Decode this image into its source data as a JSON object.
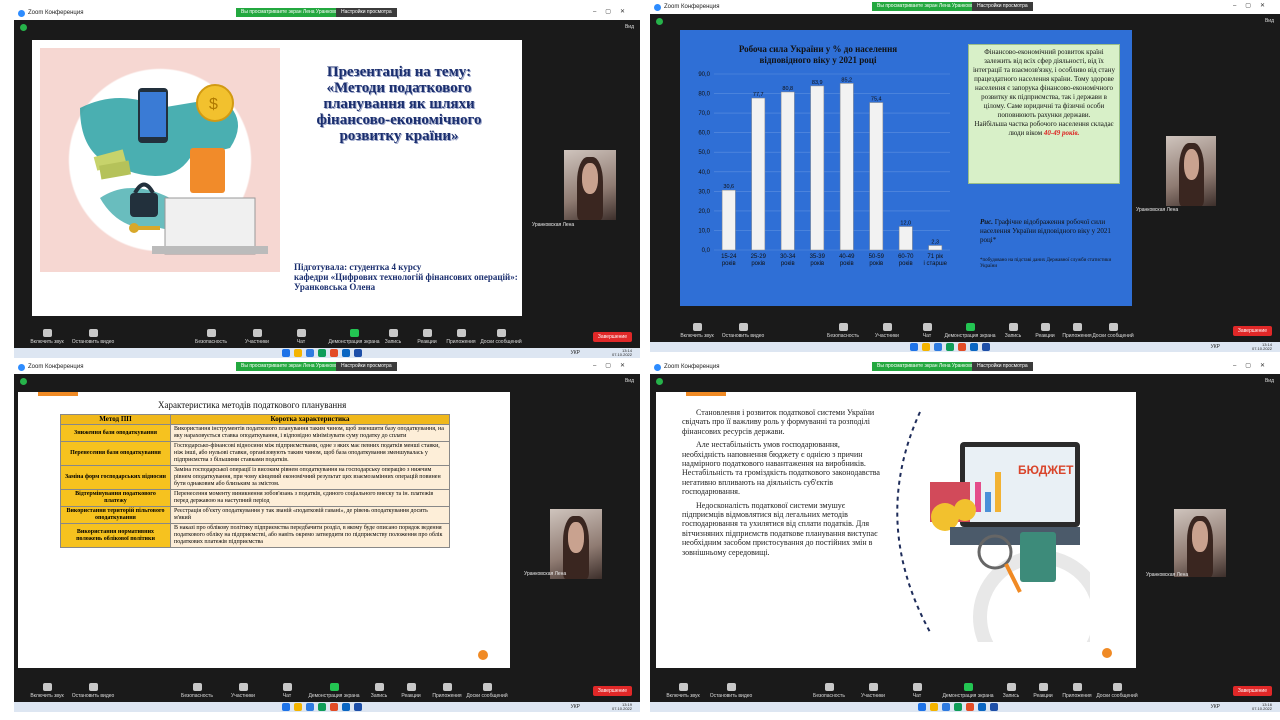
{
  "zoom": {
    "app_title": "Zoom Конференция",
    "share_banner": "Вы просматриваете экран Лена Уранковская",
    "view_settings": "Настройки просмотра",
    "view_label": "Вид",
    "participant_name": "Уранковская Лена",
    "participants_count": "11",
    "end_label": "Завершение",
    "toolbar": {
      "audio": "Включить звук",
      "video": "Остановить видео",
      "security": "Безопасность",
      "participants": "Участники",
      "chat": "Чат",
      "share": "Демонстрация экрана",
      "record": "Запись",
      "reactions": "Реакции",
      "apps": "Приложения",
      "whiteboards": "Доски сообщений"
    }
  },
  "taskbar": {
    "lang": "УКР",
    "times": [
      "13:14",
      "13:14",
      "13:19",
      "13:16"
    ],
    "date": "07.10.2022",
    "icon_colors": [
      "#1e73e8",
      "#f4b400",
      "#2f7be0",
      "#0f9d58",
      "#e34c26",
      "#0a66c2",
      "#1e4fa8"
    ]
  },
  "slide1": {
    "title": "Презентація на тему: «Методи податкового планування як шляхи фінансово-економічного розвитку країни»",
    "prepared_line1": "Підготувала: студентка 4 курсу",
    "prepared_line2": "кафедри «Цифрових технологій фінансових операцій»:",
    "prepared_line3": "Уранковська Олена"
  },
  "slide2": {
    "info_text": "Фінансово-економічний розвиток країні залежить від всіх сфер діяльності, від їх інтеграції та взаємозв'язку, і особливо від стану працездатного населення країни. Тому здорове населення є запорука фінансово-економічного розвитку як підприємства, так і держави в цілому. Саме юридичні та фізичні особи поповнюють рахунки держави.",
    "info_highlight_prefix": "Найбільша частка робочого населення складає люди віком",
    "info_highlight": "40-49 років.",
    "caption_label": "Рис.",
    "caption": "Графічне відображення робочої сили населення України відповідного віку у 2021 році*",
    "caption_note": "*побудовано на підставі даних Державної служби статистики України"
  },
  "chart_data": {
    "type": "bar",
    "title": "Робоча сила України у % до населення відповідного віку у 2021 році",
    "categories": [
      "15-24 років",
      "25-29 років",
      "30-34 років",
      "35-39 років",
      "40-49 років",
      "50-59 років",
      "60-70 років",
      "71 рік і старше"
    ],
    "values": [
      30.6,
      77.7,
      80.8,
      83.9,
      85.2,
      75.4,
      12.0,
      2.3
    ],
    "value_labels": [
      "30,6",
      "77,7",
      "80,8",
      "83,9",
      "85,2",
      "75,4",
      "12,0",
      "2,3"
    ],
    "y_ticks": [
      "0,0",
      "10,0",
      "20,0",
      "30,0",
      "40,0",
      "50,0",
      "60,0",
      "70,0",
      "80,0",
      "90,0"
    ],
    "ylim": [
      0,
      90
    ],
    "grid": true,
    "bar_color": "#f2f2f2"
  },
  "slide3": {
    "heading": "Характеристика методів податкового планування",
    "col_method": "Метод ПП",
    "col_desc": "Коротка характеристика",
    "rows": [
      {
        "method": "Зниження бази оподаткування",
        "desc": "Використання інструментів податкового планування таким чином, щоб зменшити базу оподаткування, на яку нараховується ставка оподаткування, і відповідно мінімізувати суму податку до сплати"
      },
      {
        "method": "Перенесення бази оподаткування",
        "desc": "Господарсько-фінансові відносини між підприємствами, одне з яких має певних податків менші ставки, ніж інші, або нульові ставки, організовують таким чином, щоб база оподаткування зменшувалась у підприємства з більшими ставками податків."
      },
      {
        "method": "Заміна форм господарських відносин",
        "desc": "Заміна господарської операції із високим рівнем оподаткування на господарську операцію з нижчим рівнем оподаткування, при чому кінцевий економічний результат цих взаємозамінних операцій повинен бути однаковим або близьким за змістом."
      },
      {
        "method": "Відтермінування податкового платежу",
        "desc": "Перенесення моменту виникнення зобов'язань з податків, єдиного соціального внеску та ін. платежів перед державою на наступний період"
      },
      {
        "method": "Використання територій пільгового оподаткування",
        "desc": "Реєстрація об'єкту оподаткування у так званій «податковій гавані», де рівень оподаткування досить м'який"
      },
      {
        "method": "Використання нормативних положень облікової політики",
        "desc": "В наказі про облікову політику підприємства передбачити розділ, в якому буде описано порядок ведення податкового обліку на підприємстві, або навіть окремо затвердити по підприємству положення про облік податкових платежів підприємства"
      }
    ]
  },
  "slide4": {
    "p1": "Становлення і розвиток податкової системи України свідчать про її важливу роль у формуванні та розподілі фінансових ресурсів держави.",
    "p2": "Але нестабільність умов господарювання, необхідність наповнення бюджету є однією з причин надмірного податкового навантаження на виробників. Нестабільність та громіздкість податкового законодавства негативно впливають на діяльність суб'єктів господарювання.",
    "p3": "Недосконалість податкової системи змушує підприємців відмовлятися від легальних методів господарювання та ухилятися від сплати податків. Для вітчизняних підприємств податкове планування виступає необхідним засобом пристосування до постійних змін в зовнішньому середовищі.",
    "budget_label": "БЮДЖЕТ"
  }
}
